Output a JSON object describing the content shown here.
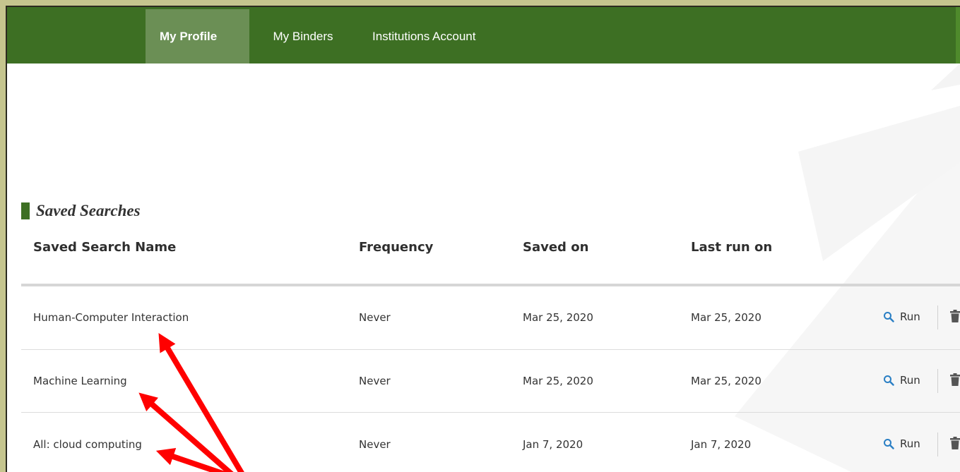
{
  "nav": {
    "items": [
      {
        "label": "My Profile",
        "active": true
      },
      {
        "label": "My Binders",
        "active": false
      },
      {
        "label": "Institutions Account",
        "active": false
      }
    ]
  },
  "section": {
    "title": "Saved Searches"
  },
  "table": {
    "columns": [
      "Saved Search Name",
      "Frequency",
      "Saved on",
      "Last run on"
    ],
    "rows": [
      {
        "name": "Human-Computer Interaction",
        "frequency": "Never",
        "saved_on": "Mar 25, 2020",
        "last_run_on": "Mar 25, 2020",
        "run_label": "Run"
      },
      {
        "name": "Machine Learning",
        "frequency": "Never",
        "saved_on": "Mar 25, 2020",
        "last_run_on": "Mar 25, 2020",
        "run_label": "Run"
      },
      {
        "name": "All: cloud computing",
        "frequency": "Never",
        "saved_on": "Jan 7, 2020",
        "last_run_on": "Jan 7, 2020",
        "run_label": "Run"
      }
    ]
  },
  "icons": {
    "run": "search-icon",
    "delete": "trash-icon"
  },
  "colors": {
    "nav_bg": "#3d6f23",
    "nav_active": "#6b8f55",
    "accent_bar": "#3d6f23",
    "search_icon": "#2a7fc4",
    "annotation_arrow": "#ff0000"
  }
}
